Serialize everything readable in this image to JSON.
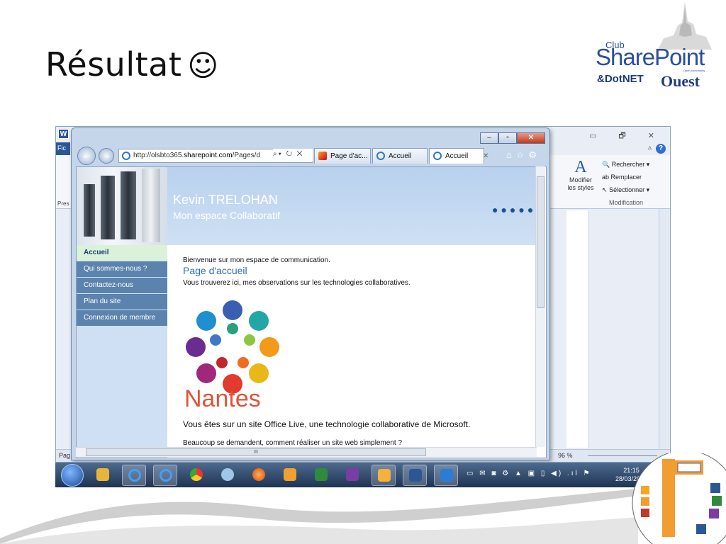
{
  "slide": {
    "title": "Résultat",
    "title_symbol": "☺"
  },
  "logo": {
    "club": "Club",
    "name": "SharePoint",
    "tagline": "Open community",
    "dotnet": "&DotNET",
    "region": "Ouest"
  },
  "word": {
    "app_icon": "W",
    "file_tab": "Fic",
    "left_label": "Pres",
    "status_left": "Pag",
    "zoom": "96 %",
    "modify_styles_line1": "Modifier",
    "modify_styles_line2": "les styles",
    "edit_find": "Rechercher",
    "edit_replace": "Remplacer",
    "edit_select": "Sélectionner",
    "edit_group_label": "Modification"
  },
  "ie": {
    "address_prefix": "http://olsbto365.",
    "address_host": "sharepoint.com",
    "address_suffix": "/Pages/d",
    "tabs": [
      {
        "label": "Page d'ac..."
      },
      {
        "label": "Accueil"
      },
      {
        "label": "Accueil"
      }
    ],
    "page": {
      "owner_name": "Kevin TRELOHAN",
      "site_subtitle": "Mon espace Collaboratif",
      "nav": [
        {
          "label": "Accueil"
        },
        {
          "label": "Qui sommes-nous ?"
        },
        {
          "label": "Contactez-nous"
        },
        {
          "label": "Plan du site"
        },
        {
          "label": "Connexion de membre"
        }
      ],
      "welcome": "Bienvenue sur mon espace de communication.",
      "heading": "Page d'accueil",
      "intro": "Vous trouverez ici, mes observations sur les technologies collaboratives.",
      "city_logo_text": "Nantes",
      "office_live": "Vous êtes sur un site Office Live, une technologie collaborative de Microsoft.",
      "question": "Beaucoup se demandent, comment réaliser un site web simplement ?"
    }
  },
  "taskbar": {
    "time": "21:15",
    "date": "28/03/2012"
  },
  "colors": {
    "banner": "#c4d9f1",
    "nav_item": "#5b83ad",
    "nav_active": "#d9f2d9",
    "heading": "#2f6db3",
    "taskbar": "#2a4266"
  }
}
